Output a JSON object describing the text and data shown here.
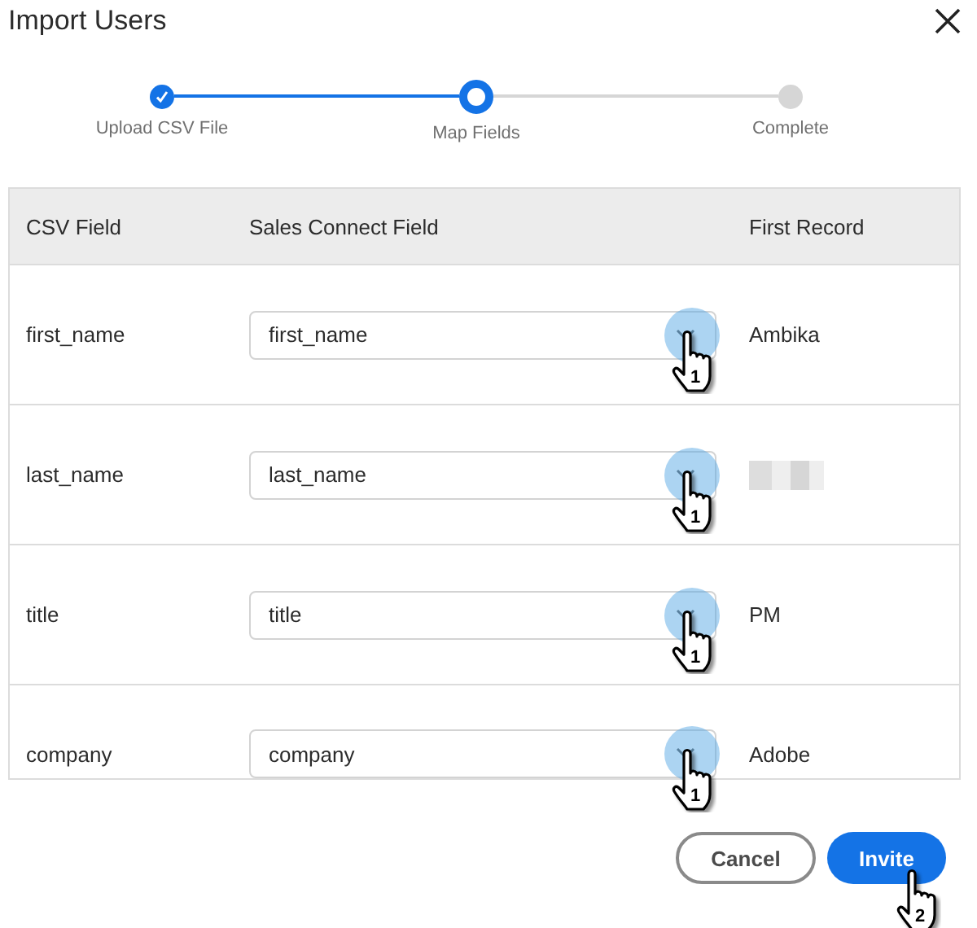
{
  "dialog": {
    "title": "Import Users"
  },
  "steps": [
    {
      "label": "Upload CSV File",
      "completed": true,
      "selected": false
    },
    {
      "label": "Map Fields",
      "completed": false,
      "selected": true
    },
    {
      "label": "Complete",
      "completed": false,
      "selected": false
    }
  ],
  "table": {
    "columns": [
      "CSV Field",
      "Sales Connect Field",
      "First Record"
    ],
    "rows": [
      {
        "csv_field": "first_name",
        "mapped_field": "first_name",
        "redacted": false,
        "first_record": "Ambika",
        "annotation": "1"
      },
      {
        "csv_field": "last_name",
        "mapped_field": "last_name",
        "redacted": true,
        "annotation": "1"
      },
      {
        "csv_field": "title",
        "mapped_field": "title",
        "redacted": false,
        "first_record": "PM",
        "annotation": "1"
      },
      {
        "csv_field": "company",
        "mapped_field": "company",
        "redacted": false,
        "first_record": "Adobe",
        "annotation": "1"
      }
    ]
  },
  "buttons": [
    {
      "label": "Cancel",
      "kind": "secondary"
    },
    {
      "label": "Invite",
      "kind": "primary",
      "annotation": "2"
    }
  ]
}
